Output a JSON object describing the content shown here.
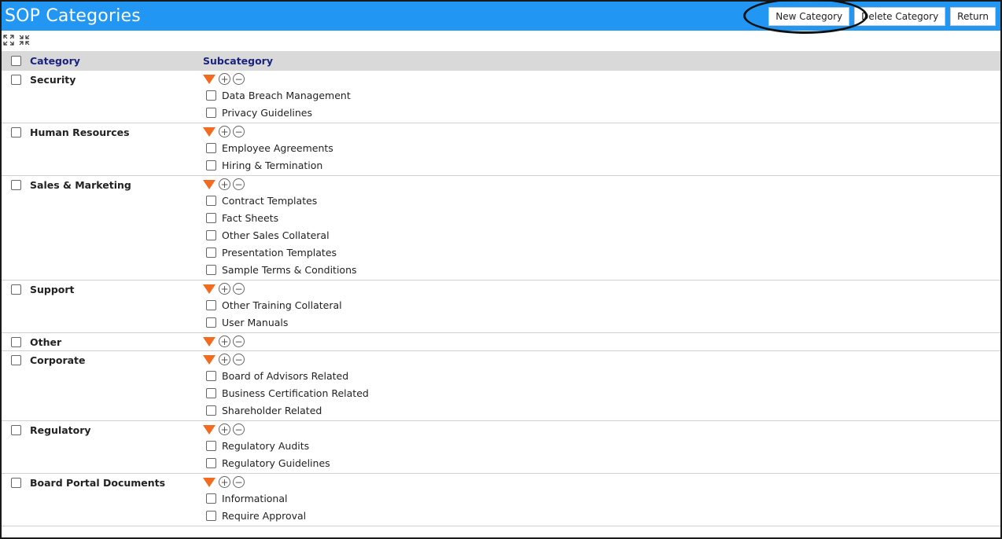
{
  "header": {
    "title": "SOP Categories",
    "buttons": {
      "new_category": "New Category",
      "delete_category": "Delete Category",
      "return": "Return"
    }
  },
  "table": {
    "columns": {
      "category": "Category",
      "subcategory": "Subcategory"
    },
    "groups": [
      {
        "name": "Security",
        "subs": [
          "Data Breach Management",
          "Privacy Guidelines"
        ]
      },
      {
        "name": "Human Resources",
        "subs": [
          "Employee Agreements",
          "Hiring & Termination"
        ]
      },
      {
        "name": "Sales & Marketing",
        "subs": [
          "Contract Templates",
          "Fact Sheets",
          "Other Sales Collateral",
          "Presentation Templates",
          "Sample Terms & Conditions"
        ]
      },
      {
        "name": "Support",
        "subs": [
          "Other Training Collateral",
          "User Manuals"
        ]
      },
      {
        "name": "Other",
        "subs": []
      },
      {
        "name": "Corporate",
        "subs": [
          "Board of Advisors Related",
          "Business Certification Related",
          "Shareholder Related"
        ]
      },
      {
        "name": "Regulatory",
        "subs": [
          "Regulatory Audits",
          "Regulatory Guidelines"
        ]
      },
      {
        "name": "Board Portal Documents",
        "subs": [
          "Informational",
          "Require Approval"
        ]
      }
    ]
  },
  "colors": {
    "title_bar": "#2196f3",
    "accent_triangle": "#f26b21",
    "header_text": "#1a237e"
  }
}
